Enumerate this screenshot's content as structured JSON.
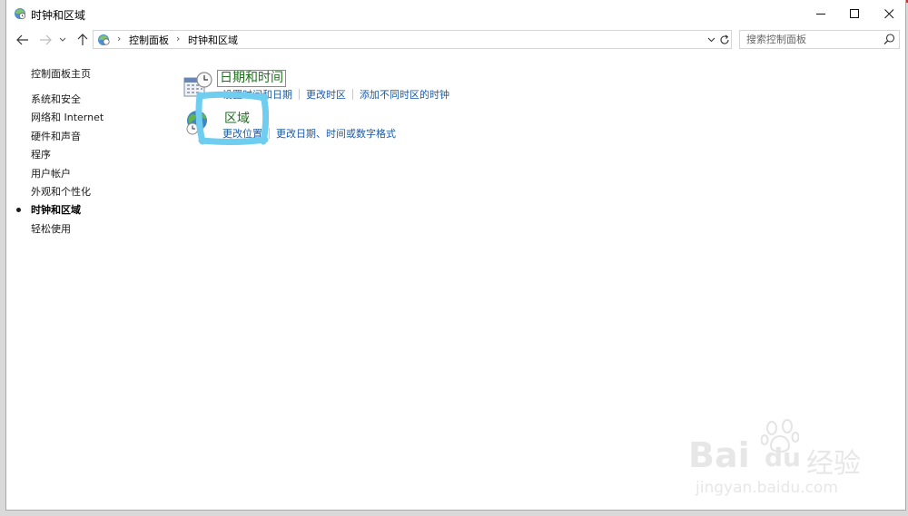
{
  "window": {
    "title": "时钟和区域"
  },
  "address_bar": {
    "breadcrumb": [
      "控制面板",
      "时钟和区域"
    ]
  },
  "search": {
    "placeholder": "搜索控制面板"
  },
  "sidebar": {
    "home": "控制面板主页",
    "items": [
      {
        "label": "系统和安全",
        "active": false
      },
      {
        "label": "网络和 Internet",
        "active": false
      },
      {
        "label": "硬件和声音",
        "active": false
      },
      {
        "label": "程序",
        "active": false
      },
      {
        "label": "用户帐户",
        "active": false
      },
      {
        "label": "外观和个性化",
        "active": false
      },
      {
        "label": "时钟和区域",
        "active": true
      },
      {
        "label": "轻松使用",
        "active": false
      }
    ]
  },
  "categories": [
    {
      "title": "日期和时间",
      "icon": "calendar-clock-icon",
      "links": [
        "设置时间和日期",
        "更改时区",
        "添加不同时区的时钟"
      ]
    },
    {
      "title": "区域",
      "icon": "globe-clock-icon",
      "links": [
        "更改位置",
        "更改日期、时间或数字格式"
      ]
    }
  ],
  "watermark": {
    "brand": "Bai",
    "brand_tail": "du",
    "label": "经验",
    "url": "jingyan.baidu.com"
  },
  "colors": {
    "category_title": "#1e6e1e",
    "link": "#1b5aa6",
    "highlight_marker": "#6fcdf0"
  }
}
